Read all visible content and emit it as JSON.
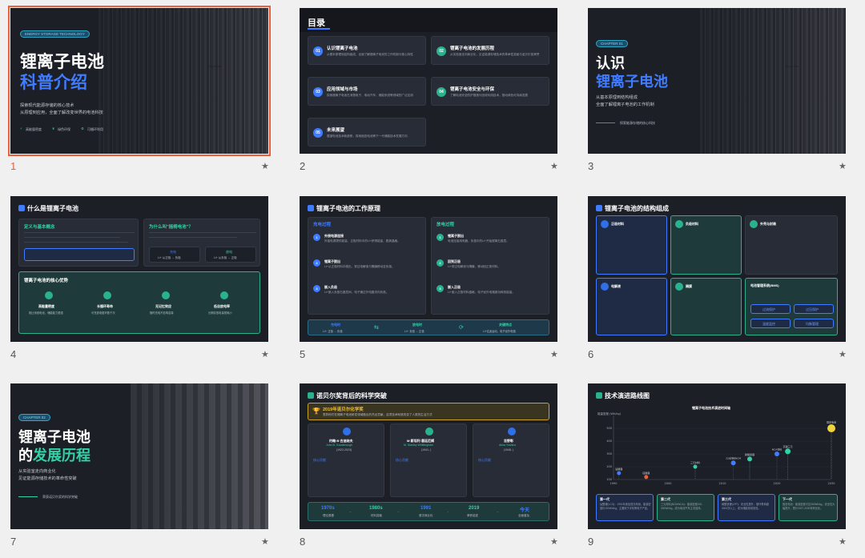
{
  "slides": [
    {
      "number": "1",
      "pill": "ENERGY STORAGE TECHNOLOGY",
      "title1": "锂离子电池",
      "title2": "科普介绍",
      "sub1": "探索现代能源存储的核心技术",
      "sub2": "从原理到应用，全面了解改变世界的电池科技",
      "feat1": "高能量密度",
      "feat2": "绿色环保",
      "feat3": "可循环利用",
      "photo_label": "Separator"
    },
    {
      "number": "2",
      "title": "目录",
      "items": [
        {
          "n": "01",
          "t": "认识锂离子电池",
          "d": "从基本原理到结构组成，全面了解锂离子电池的工作机制与核心特性"
        },
        {
          "n": "02",
          "t": "锂离子电池的发展历程",
          "d": "从实验室走向商业化，见证能源存储技术的革命性突破与诺贝尔奖荣誉"
        },
        {
          "n": "03",
          "t": "应用领域与市场",
          "d": "探索锂离子电池在消费电子、电动汽车、储能系统等领域的广泛应用"
        },
        {
          "n": "04",
          "t": "锂离子电池安全与环保",
          "d": "了解电池安全防护措施与回收利用技术，推动绿色可持续发展"
        },
        {
          "n": "05",
          "t": "未来展望",
          "d": "展望电池技术新趋势，探索固态电池等下一代储能技术发展方向"
        }
      ]
    },
    {
      "number": "3",
      "pill": "CHAPTER 01",
      "title1": "认识",
      "title2": "锂离子电池",
      "sub1": "从基本原理到结构组成",
      "sub2": "全面了解锂离子电池的工作机制",
      "foot": "探索能源存储的核心科技",
      "photo_label": "Separator"
    },
    {
      "number": "4",
      "title": "什么是锂离子电池",
      "box1_title": "定义与基本概念",
      "box2_title": "为什么叫\"摇椅电池\"？",
      "box2_l": "充电",
      "box2_r": "放电",
      "box2_l_sub": "Li+ 从正极 → 负极",
      "box2_r_sub": "Li+ 从负极 → 正极",
      "box3_title": "锂离子电池的核心优势",
      "adv": [
        "高能量密度",
        "长循环寿命",
        "无记忆效应",
        "低自放电率"
      ],
      "adv_d": [
        "相比传统电池，储能能力更强",
        "可充放电循环数千次",
        "随时充电不影响容量",
        "长期存放电量损耗小"
      ]
    },
    {
      "number": "5",
      "title": "锂离子电池的工作原理",
      "left_title": "充电过程",
      "right_title": "放电过程",
      "left": [
        "外接电源连接",
        "锂离子脱出",
        "嵌入负极"
      ],
      "right": [
        "锂离子脱出",
        "回到正极",
        "嵌入正极"
      ],
      "left_d": [
        "外接电源提供能量，正极材料中的Li+获得能量，脱离晶格。",
        "Li+从正极材料中脱出，穿过电解液与隔膜移动至负极。",
        "Li+嵌入负极石墨层间，电子通过外电路流向负极。"
      ],
      "right_d": [
        "电池连接用电器，负极中的Li+开始脱离石墨层。",
        "Li+穿过电解液与隔膜，移动回正极材料。",
        "Li+嵌入正极材料晶格，电子经外电路做功释放能量。"
      ],
      "bar": [
        "充电时",
        "放电时",
        "关键特点"
      ],
      "bar_d": [
        "Li+: 正极 → 负极",
        "Li+: 负极 → 正极",
        "Li+往返运动，电子经外电路"
      ]
    },
    {
      "number": "6",
      "title": "锂离子电池的结构组成",
      "parts": [
        "正极材料",
        "负极材料",
        "外壳与封装",
        "电解液",
        "隔膜",
        "电池管理系统(BMS)"
      ],
      "bms": [
        "过流保护",
        "过压保护",
        "温度监控",
        "均衡管理"
      ]
    },
    {
      "number": "7",
      "pill": "CHAPTER 02",
      "title1": "锂离子电池",
      "title2a": "的",
      "title2b": "发展历程",
      "sub1": "从实验室走向商业化",
      "sub2": "见证能源存储技术的革命性突破",
      "foot": "荣获诺贝尔奖的科学突破"
    },
    {
      "number": "8",
      "title": "诺贝尔奖背后的科学突破",
      "banner_title": "2019年诺贝尔化学奖",
      "banner_d": "表彰他们在锂离子电池研发领域做出的杰出贡献，这项技术彻底改变了人类的生活方式",
      "people": [
        {
          "cn": "约翰·B·古迪纳夫",
          "en": "John B. Goodenough",
          "years": "(1922-2023)",
          "k": "核心贡献"
        },
        {
          "cn": "M·斯坦利·惠廷厄姆",
          "en": "M. Stanley Whittingham",
          "years": "(1941- )",
          "k": "核心贡献"
        },
        {
          "cn": "吉野彰",
          "en": "Akira Yoshino",
          "years": "(1948- )",
          "k": "核心贡献"
        }
      ],
      "timeline": [
        {
          "y": "1970s",
          "d": "理论奠基"
        },
        {
          "y": "1980s",
          "d": "材料突破"
        },
        {
          "y": "1991",
          "d": "首次商业化"
        },
        {
          "y": "2019",
          "d": "荣获诺奖"
        },
        {
          "y": "今天",
          "d": "全面普及"
        }
      ]
    },
    {
      "number": "9",
      "title": "技术演进路线图",
      "chart_title": "锂离子电池技术演进时间轴",
      "cards": [
        {
          "t": "第一代",
          "d": "钴酸锂(LCO)：1991年索尼首次商用，能量密度约150Wh/kg，主要用于手机等电子产品。"
        },
        {
          "t": "第二代",
          "d": "三元材料(NCM/NCA)：能量密度200-300Wh/kg，成为电动汽车主流选择。"
        },
        {
          "t": "第三代",
          "d": "磷酸铁锂(LFP)：安全性提升，循环寿命超3000次以上，成为储能领域首选。"
        },
        {
          "t": "下一代",
          "d": "固态电池：能量密度可达500Wh/kg，安全性大幅提升，预计2027-2030年商业化。"
        }
      ]
    }
  ],
  "chart_data": {
    "type": "scatter",
    "title": "锂离子电池技术演进时间轴",
    "xlabel": "",
    "ylabel": "能量密度 (Wh/kg)",
    "xlim": [
      1990,
      2030
    ],
    "ylim": [
      100,
      600
    ],
    "x_ticks": [
      "1990",
      "2000",
      "2010",
      "2020",
      "2030"
    ],
    "y_ticks": [
      "100",
      "200",
      "300",
      "400",
      "500"
    ],
    "points": [
      {
        "label": "钴酸锂",
        "x": 1991,
        "y": 150
      },
      {
        "label": "锰酸锂",
        "x": 1996,
        "y": 120
      },
      {
        "label": "三元材料",
        "x": 2005,
        "y": 200
      },
      {
        "label": "三元材料NCM",
        "x": 2012,
        "y": 230
      },
      {
        "label": "磷酸铁锂",
        "x": 2015,
        "y": 260
      },
      {
        "label": "NCA材料",
        "x": 2020,
        "y": 300
      },
      {
        "label": "高镍三元",
        "x": 2022,
        "y": 320
      },
      {
        "label": "固态电池",
        "x": 2030,
        "y": 500
      }
    ],
    "legend": "none"
  }
}
